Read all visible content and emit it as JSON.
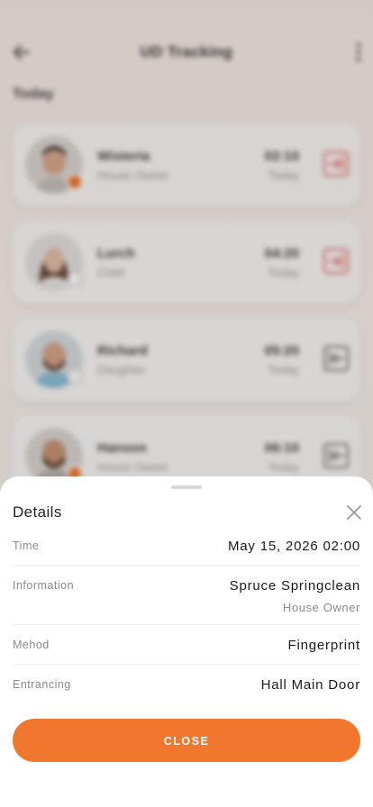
{
  "header": {
    "title": "UD Tracking"
  },
  "section_label": "Today",
  "entries": [
    {
      "name": "Wisteria",
      "role": "House Owner",
      "time": "02:10",
      "day": "Today",
      "badge": "orange",
      "entry_icon": "log-in-icon"
    },
    {
      "name": "Lurch",
      "role": "Child",
      "time": "04:20",
      "day": "Today",
      "badge": "white",
      "entry_icon": "log-in-icon"
    },
    {
      "name": "Richard",
      "role": "Daughter",
      "time": "05:20",
      "day": "Today",
      "badge": "white",
      "entry_icon": "log-out-icon"
    },
    {
      "name": "Hanson",
      "role": "House Owner",
      "time": "06:10",
      "day": "Today",
      "badge": "orange",
      "entry_icon": "log-out-icon"
    }
  ],
  "details": {
    "title": "Details",
    "rows": [
      {
        "label": "Time",
        "value": "May 15, 2026 02:00"
      },
      {
        "label": "Information",
        "value": "Spruce Springclean",
        "sub": "House Owner"
      },
      {
        "label": "Mehod",
        "value": "Fingerprint"
      },
      {
        "label": "Entrancing",
        "value": "Hall Main Door"
      }
    ],
    "close_label": "CLOSE"
  },
  "colors": {
    "accent": "#F2772E",
    "login_icon": "#E06A6A",
    "logout_icon": "#6A6A6A"
  }
}
